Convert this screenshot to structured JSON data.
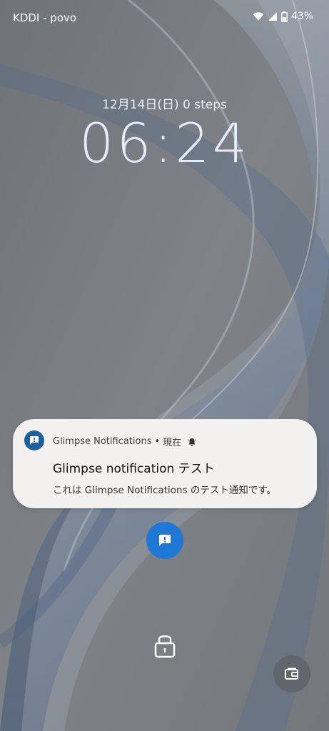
{
  "status_bar": {
    "carrier": "KDDI - povo",
    "battery": "43%",
    "icons": [
      "wifi-icon",
      "signal-icon",
      "battery-icon"
    ]
  },
  "lockscreen": {
    "date_steps": "12月14日(日)  0 steps",
    "time": "06:24"
  },
  "notification": {
    "app_name": "Glimpse Notifications",
    "time": "現在",
    "header_separator": "•",
    "title": "Glimpse notification テスト",
    "body": "これは Glimpse Notifications のテスト通知です。",
    "icons": [
      "glimpse-app-icon",
      "alert-bell-icon"
    ]
  },
  "bottom": {
    "icons": [
      "glimpse-notification-icon",
      "lock-icon",
      "wallet-icon"
    ]
  },
  "colors": {
    "accent_blue": "#1f78d6",
    "app_icon_blue": "#1d5fa0",
    "card_bg": "#f2f1ef",
    "wallpaper_gray": "#7a7e82"
  }
}
